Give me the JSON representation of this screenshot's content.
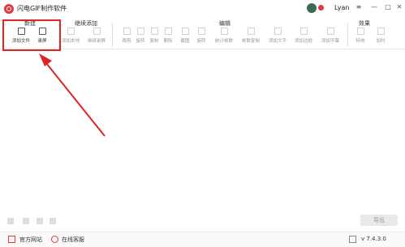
{
  "app": {
    "title": "闪电GIF制作软件",
    "user": "Lyan"
  },
  "colors": {
    "brand": "#e03a3a",
    "highlight": "#e02424"
  },
  "ribbon": {
    "groups": [
      "新建",
      "继续添加",
      "编辑",
      "效果"
    ],
    "new_tools": [
      "添加文件",
      "录屏"
    ],
    "continue_tools": [
      "添加本地",
      "继续录屏"
    ],
    "edit_tools": [
      "裁剪",
      "旋转",
      "复制",
      "删除",
      "截图",
      "旋转",
      "统计帧数",
      "帧数复制",
      "添加文字",
      "添加边框",
      "添加字幕"
    ],
    "effect_tools": [
      "特效",
      "加时"
    ]
  },
  "playback": {
    "export_label": "导出"
  },
  "status": {
    "website": "官方网站",
    "support": "在线客服",
    "version": "v 7.4.3.0"
  }
}
